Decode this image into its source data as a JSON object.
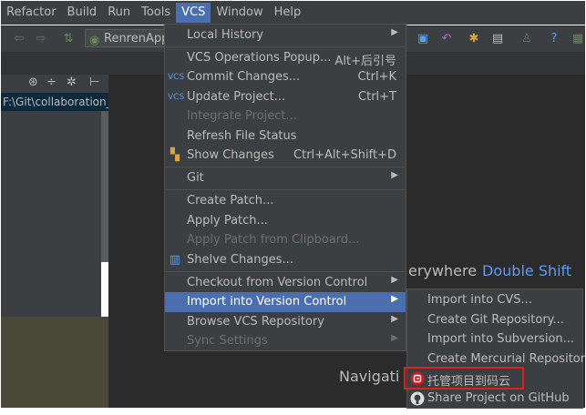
{
  "menubar": {
    "items": [
      "Refactor",
      "Build",
      "Run",
      "Tools",
      "VCS",
      "Window",
      "Help"
    ],
    "active": "VCS"
  },
  "toolbar": {
    "run_config": "RenrenAppl"
  },
  "project_panel": {
    "path": "F:\\Git\\collaboration_"
  },
  "vcs_menu": {
    "items": [
      {
        "label": "Local History",
        "arrow": true
      },
      {
        "label": "VCS Operations Popup...",
        "shortcut": "Alt+后引号"
      },
      {
        "label": "Commit Changes...",
        "shortcut": "Ctrl+K",
        "icon": "vcs-commit-icon"
      },
      {
        "label": "Update Project...",
        "shortcut": "Ctrl+T",
        "icon": "vcs-update-icon"
      },
      {
        "label": "Integrate Project...",
        "disabled": true
      },
      {
        "label": "Refresh File Status"
      },
      {
        "label": "Show Changes",
        "shortcut": "Ctrl+Alt+Shift+D",
        "icon": "show-changes-icon"
      },
      {
        "label": "Git",
        "arrow": true
      },
      {
        "label": "Create Patch..."
      },
      {
        "label": "Apply Patch..."
      },
      {
        "label": "Apply Patch from Clipboard...",
        "disabled": true
      },
      {
        "label": "Shelve Changes...",
        "icon": "shelve-icon"
      },
      {
        "label": "Checkout from Version Control",
        "arrow": true
      },
      {
        "label": "Import into Version Control",
        "arrow": true,
        "selected": true
      },
      {
        "label": "Browse VCS Repository",
        "arrow": true
      },
      {
        "label": "Sync Settings",
        "arrow": true,
        "disabled": true
      }
    ]
  },
  "import_submenu": {
    "items": [
      {
        "label": "Import into CVS..."
      },
      {
        "label": "Create Git Repository..."
      },
      {
        "label": "Import into Subversion..."
      },
      {
        "label": "Create Mercurial Repository"
      },
      {
        "label": "托管项目到码云",
        "icon": "gitee-icon",
        "highlighted": true
      },
      {
        "label": "Share Project on GitHub",
        "icon": "github-icon"
      }
    ]
  },
  "editor_hints": {
    "search_everywhere": "erywhere",
    "double_shift": "Double Shift",
    "navigation": "Navigati"
  },
  "colors": {
    "accent": "#4b6eaf",
    "highlight_border": "#e02020",
    "link": "#589df6"
  }
}
